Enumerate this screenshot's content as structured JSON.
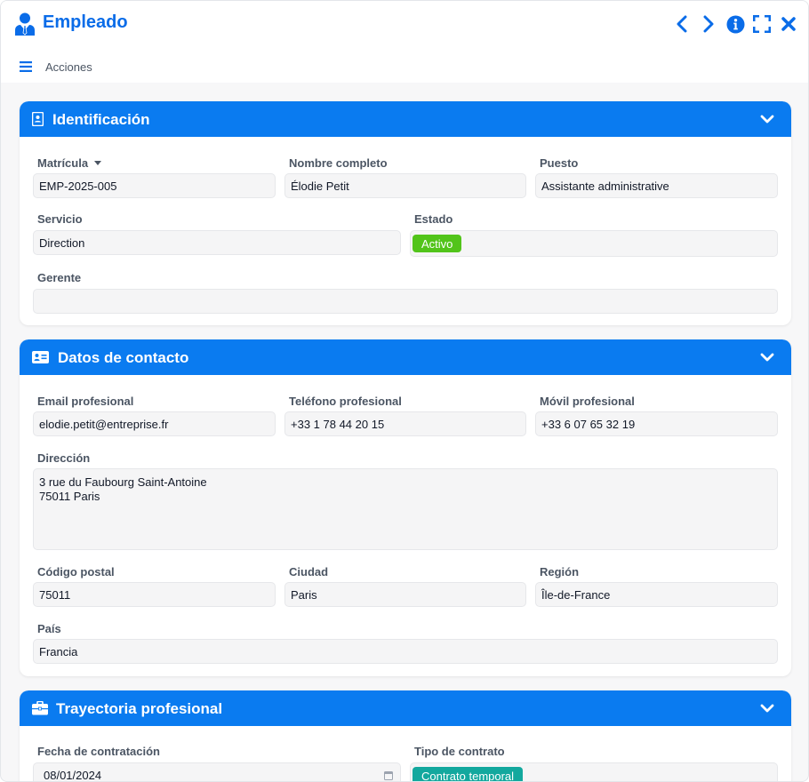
{
  "window": {
    "title": "Empleado",
    "title_icon": "user-tie-icon"
  },
  "title_actions": [
    "chevron-left-icon",
    "chevron-right-icon",
    "info-circle-icon",
    "expand-icon",
    "close-icon"
  ],
  "toolbar": {
    "menu_label": "Acciones",
    "menu_icon": "hamburger-icon"
  },
  "colors": {
    "accent": "#0a7bf0",
    "title": "#0a6ce8",
    "status_active": "#52c41a",
    "contract_badge": "#13a89e"
  },
  "sections": {
    "identification": {
      "title": "Identificación",
      "icon": "id-card-icon",
      "matricula_label": "Matrícula",
      "matricula_value": "EMP-2025-005",
      "nombre_label": "Nombre completo",
      "nombre_value": "Élodie Petit",
      "puesto_label": "Puesto",
      "puesto_value": "Assistante administrative",
      "servicio_label": "Servicio",
      "servicio_value": "Direction",
      "estado_label": "Estado",
      "estado_value": "Activo",
      "gerente_label": "Gerente",
      "gerente_value": ""
    },
    "contact": {
      "title": "Datos de contacto",
      "icon": "address-card-icon",
      "email_label": "Email profesional",
      "email_value": "elodie.petit@entreprise.fr",
      "tel_label": "Teléfono profesional",
      "tel_value": "+33 1 78 44 20 15",
      "movil_label": "Móvil profesional",
      "movil_value": "+33 6 07 65 32 19",
      "direccion_label": "Dirección",
      "direccion_value": "3 rue du Faubourg Saint-Antoine\n75011 Paris",
      "cp_label": "Código postal",
      "cp_value": "75011",
      "ciudad_label": "Ciudad",
      "ciudad_value": "Paris",
      "region_label": "Región",
      "region_value": "Île-de-France",
      "pais_label": "País",
      "pais_value": "Francia"
    },
    "career": {
      "title": "Trayectoria profesional",
      "icon": "briefcase-icon",
      "fecha_label": "Fecha de contratación",
      "fecha_value": "08/01/2024",
      "tipo_label": "Tipo de contrato",
      "tipo_value": "Contrato temporal"
    }
  }
}
